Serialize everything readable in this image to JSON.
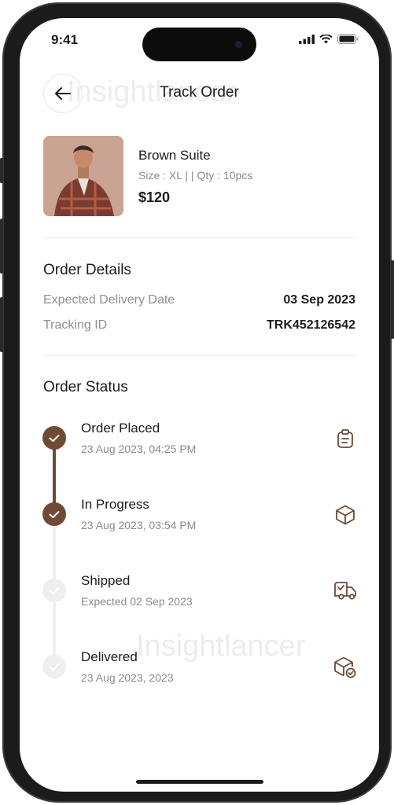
{
  "status_bar": {
    "time": "9:41"
  },
  "header": {
    "title": "Track Order",
    "back_icon": "arrow-left-icon"
  },
  "watermark": "Insightlancer",
  "product": {
    "name": "Brown Suite",
    "meta": "Size : XL | | Qty : 10pcs",
    "price": "$120"
  },
  "order_details": {
    "title": "Order Details",
    "rows": [
      {
        "label": "Expected Delivery Date",
        "value": "03 Sep 2023"
      },
      {
        "label": "Tracking ID",
        "value": "TRK452126542"
      }
    ]
  },
  "order_status": {
    "title": "Order Status",
    "steps": [
      {
        "title": "Order Placed",
        "subtitle": "23 Aug 2023, 04:25 PM",
        "done": true,
        "icon": "clipboard-icon"
      },
      {
        "title": "In Progress",
        "subtitle": "23 Aug 2023, 03:54 PM",
        "done": true,
        "icon": "box-icon"
      },
      {
        "title": "Shipped",
        "subtitle": "Expected 02 Sep 2023",
        "done": false,
        "icon": "truck-icon"
      },
      {
        "title": "Delivered",
        "subtitle": "23 Aug 2023, 2023",
        "done": false,
        "icon": "box-check-icon"
      }
    ]
  },
  "colors": {
    "accent": "#6f4a34",
    "pending": "#efefef",
    "muted_text": "#8a8a8a"
  }
}
